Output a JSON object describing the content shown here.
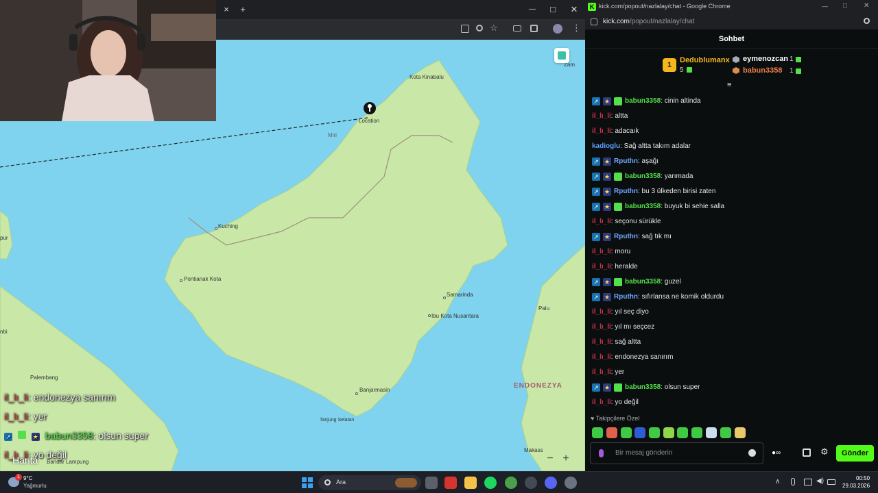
{
  "left_browser": {
    "close_tab": "×",
    "new_tab": "+",
    "win_min": "—",
    "win_max": "□",
    "win_close": "✕"
  },
  "map": {
    "labels": {
      "kota_kinabalu": "Kota Kinabalu",
      "location": "Location",
      "miri": "Miri",
      "kuching": "Kuching",
      "pontianak": "Pontianak Kota",
      "samarinda": "Samarinda",
      "ibu_kota": "Ibu Kota Nusantara",
      "palembang": "Palembang",
      "banjarmasin": "Banjarmasin",
      "tanjung": "Tanjung Selatan",
      "endonezya": "ENDONEZYA",
      "palu": "Palu",
      "makassar": "Makass",
      "zami": "Zam",
      "pur": "pur",
      "nbi": "nbi",
      "lampung": "Bandar Lampung"
    },
    "zoom_out": "−",
    "zoom_in": "+",
    "harita_label": "Harita"
  },
  "stream_overlay": [
    {
      "user": "il_lı_li",
      "text": ": endonezya sanırım",
      "color": "red"
    },
    {
      "user": "il_lı_li",
      "text": ": yer",
      "color": "red"
    },
    {
      "user": "babun3358",
      "text": ": olsun super",
      "color": "green"
    },
    {
      "user": "il_lı_li",
      "text": ": yo değil",
      "color": "red"
    }
  ],
  "right_browser": {
    "title": "kick.com/popout/nazlalay/chat - Google Chrome",
    "url_host": "kick.com",
    "url_path": "/popout/nazlalay/chat",
    "chat_header": "Sohbet"
  },
  "leaderboard": {
    "first": {
      "rank": "1",
      "name": "Dedublumanx",
      "count": "5"
    },
    "second": {
      "name": "eymenozcan",
      "count": "1"
    },
    "third": {
      "name": "babun3358",
      "count": "1"
    }
  },
  "chat": [
    {
      "badges": [
        "mod",
        "vip",
        "sub"
      ],
      "user": "babun3358",
      "ucolor": "green",
      "text": ": cinin altinda"
    },
    {
      "badges": [],
      "user": "il_lı_li",
      "ucolor": "red",
      "text": ": altta"
    },
    {
      "badges": [],
      "user": "il_lı_li",
      "ucolor": "red",
      "text": ": adacaık"
    },
    {
      "badges": [],
      "user": "kadioglu",
      "ucolor": "plain",
      "text": ": Sağ altta takım adalar"
    },
    {
      "badges": [
        "mod",
        "vip"
      ],
      "user": "Rputhn",
      "ucolor": "blue",
      "text": ": aşağı"
    },
    {
      "badges": [
        "mod",
        "vip",
        "sub"
      ],
      "user": "babun3358",
      "ucolor": "green",
      "text": ": yarımada"
    },
    {
      "badges": [
        "mod",
        "vip"
      ],
      "user": "Rputhn",
      "ucolor": "blue",
      "text": ": bu 3 ülkeden birisi zaten"
    },
    {
      "badges": [
        "mod",
        "vip",
        "sub"
      ],
      "user": "babun3358",
      "ucolor": "green",
      "text": ": buyuk bi sehie salla"
    },
    {
      "badges": [],
      "user": "il_lı_li",
      "ucolor": "red",
      "text": ": seçonu sürükle"
    },
    {
      "badges": [
        "mod",
        "vip"
      ],
      "user": "Rputhn",
      "ucolor": "blue",
      "text": ": sağ tık mı"
    },
    {
      "badges": [],
      "user": "il_lı_li",
      "ucolor": "red",
      "text": ": moru"
    },
    {
      "badges": [],
      "user": "il_lı_li",
      "ucolor": "red",
      "text": ": heralde"
    },
    {
      "badges": [
        "mod",
        "vip",
        "sub"
      ],
      "user": "babun3358",
      "ucolor": "green",
      "text": ": guzel"
    },
    {
      "badges": [
        "mod",
        "vip"
      ],
      "user": "Rputhn",
      "ucolor": "blue",
      "text": ": sıfırlansa ne komik oldurdu"
    },
    {
      "badges": [],
      "user": "il_lı_li",
      "ucolor": "red",
      "text": ": yıl seç diyo"
    },
    {
      "badges": [],
      "user": "il_lı_li",
      "ucolor": "red",
      "text": ": yıl mı seçcez"
    },
    {
      "badges": [],
      "user": "il_lı_li",
      "ucolor": "red",
      "text": ": sağ altta"
    },
    {
      "badges": [],
      "user": "il_lı_li",
      "ucolor": "red",
      "text": ": endonezya sanırım"
    },
    {
      "badges": [],
      "user": "il_lı_li",
      "ucolor": "red",
      "text": ": yer"
    },
    {
      "badges": [
        "mod",
        "vip",
        "sub"
      ],
      "user": "babun3358",
      "ucolor": "green",
      "text": ": olsun super"
    },
    {
      "badges": [],
      "user": "il_lı_li",
      "ucolor": "red",
      "text": ": yo değil"
    }
  ],
  "followers_only": "Takipçilere Özel",
  "input": {
    "placeholder": "Bir mesaj gönderin"
  },
  "send_label": "Gönder",
  "taskbar": {
    "temp": "9°C",
    "weather": "Yağmurlu",
    "search": "Ara",
    "time": "00:50",
    "date": "29.03.2026",
    "notif_count": "1"
  },
  "colors": {
    "kick_green": "#53fc18",
    "water": "#7fd3ef",
    "land": "#c9e8a8",
    "chat_bg": "#0b0e0f"
  }
}
